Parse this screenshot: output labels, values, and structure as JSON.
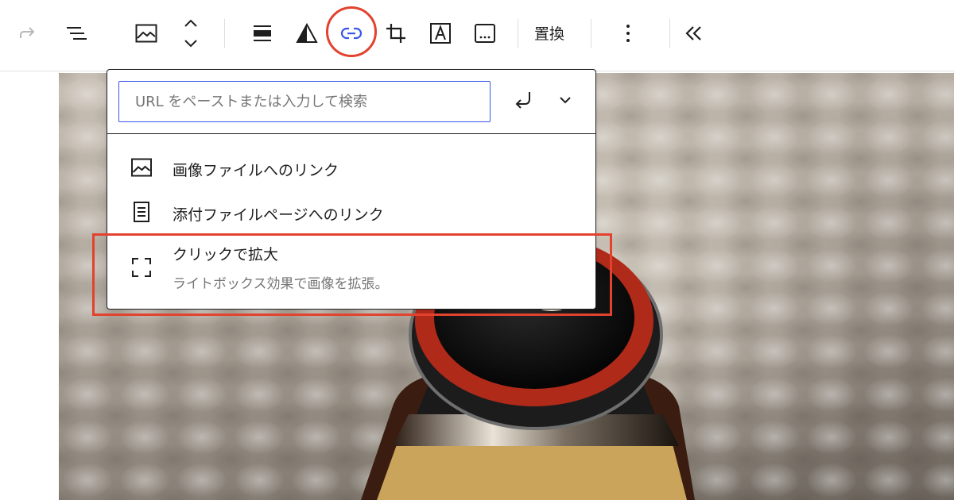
{
  "toolbar": {
    "replace_label": "置換",
    "icons": [
      "redo-icon",
      "list-view-icon",
      "image-icon",
      "move-up-down-icon",
      "align-icon",
      "duotone-icon",
      "link-icon",
      "crop-icon",
      "text-overlay-icon",
      "caption-icon",
      "more-options-icon",
      "collapse-toolbar-icon"
    ],
    "highlight_color": "#e2422e"
  },
  "link_popover": {
    "url_placeholder": "URL をペーストまたは入力して検索",
    "url_value": "",
    "options": [
      {
        "label": "画像ファイルへのリンク",
        "icon": "image-icon"
      },
      {
        "label": "添付ファイルページへのリンク",
        "icon": "page-icon"
      },
      {
        "label": "クリックで拡大",
        "description": "ライトボックス効果で画像を拡張。",
        "icon": "fullscreen-icon"
      }
    ],
    "accent_color": "#3858e9"
  }
}
